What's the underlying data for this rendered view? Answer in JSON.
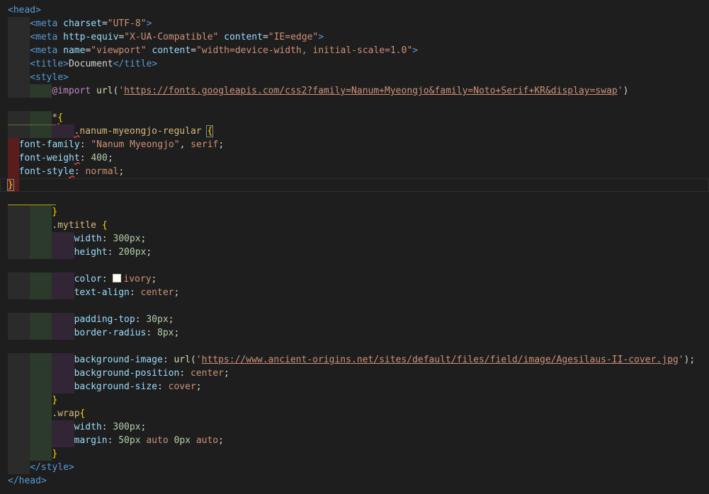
{
  "editor": {
    "lines": [
      {
        "indent": "",
        "tokens": [
          {
            "c": "t-tag",
            "t": "<head>"
          }
        ]
      },
      {
        "indent": "    ",
        "tokens": [
          {
            "c": "t-tag",
            "t": "<meta"
          },
          {
            "c": "t-text",
            "t": " "
          },
          {
            "c": "t-attr",
            "t": "charset"
          },
          {
            "c": "t-text",
            "t": "="
          },
          {
            "c": "t-str",
            "t": "\"UTF-8\""
          },
          {
            "c": "t-tag",
            "t": ">"
          }
        ]
      },
      {
        "indent": "    ",
        "tokens": [
          {
            "c": "t-tag",
            "t": "<meta"
          },
          {
            "c": "t-text",
            "t": " "
          },
          {
            "c": "t-attr",
            "t": "http-equiv"
          },
          {
            "c": "t-text",
            "t": "="
          },
          {
            "c": "t-str",
            "t": "\"X-UA-Compatible\""
          },
          {
            "c": "t-text",
            "t": " "
          },
          {
            "c": "t-attr",
            "t": "content"
          },
          {
            "c": "t-text",
            "t": "="
          },
          {
            "c": "t-str",
            "t": "\"IE=edge\""
          },
          {
            "c": "t-tag",
            "t": ">"
          }
        ]
      },
      {
        "indent": "    ",
        "tokens": [
          {
            "c": "t-tag",
            "t": "<meta"
          },
          {
            "c": "t-text",
            "t": " "
          },
          {
            "c": "t-attr",
            "t": "name"
          },
          {
            "c": "t-text",
            "t": "="
          },
          {
            "c": "t-str",
            "t": "\"viewport\""
          },
          {
            "c": "t-text",
            "t": " "
          },
          {
            "c": "t-attr",
            "t": "content"
          },
          {
            "c": "t-text",
            "t": "="
          },
          {
            "c": "t-str",
            "t": "\"width=device-width, initial-scale=1.0\""
          },
          {
            "c": "t-tag",
            "t": ">"
          }
        ]
      },
      {
        "indent": "    ",
        "tokens": [
          {
            "c": "t-tag",
            "t": "<title>"
          },
          {
            "c": "t-text",
            "t": "Document"
          },
          {
            "c": "t-tag",
            "t": "</title>"
          }
        ]
      },
      {
        "indent": "    ",
        "tokens": [
          {
            "c": "t-tag",
            "t": "<style>"
          }
        ]
      },
      {
        "indent": "        ",
        "tokens": [
          {
            "c": "t-at",
            "t": "@import"
          },
          {
            "c": "t-text",
            "t": " "
          },
          {
            "c": "t-fn",
            "t": "url"
          },
          {
            "c": "t-text",
            "t": "("
          },
          {
            "c": "t-str",
            "t": "'"
          },
          {
            "c": "t-str t-link",
            "t": "https://fonts.googleapis.com/css2?family=Nanum+Myeongjo&family=Noto+Serif+KR&display=swap"
          },
          {
            "c": "t-str",
            "t": "'"
          },
          {
            "c": "t-text",
            "t": ")"
          }
        ]
      },
      {
        "indent": "",
        "tokens": []
      },
      {
        "indent": "        ",
        "tokens": [
          {
            "c": "t-sel",
            "t": "*"
          },
          {
            "c": "t-brace squiggle",
            "t": "{"
          }
        ]
      },
      {
        "indent": "            ",
        "tokens": [
          {
            "c": "t-sel squiggle",
            "t": "."
          },
          {
            "c": "t-sel",
            "t": "nanum-myeongjo-regular "
          },
          {
            "c": "t-brace cursor-box",
            "t": "{"
          }
        ]
      },
      {
        "indent": "  ",
        "tokens": [
          {
            "c": "t-prop",
            "t": "font-family"
          },
          {
            "c": "t-text",
            "t": ": "
          },
          {
            "c": "t-val",
            "t": "\"Nanum Myeongjo\""
          },
          {
            "c": "t-text",
            "t": ", "
          },
          {
            "c": "t-val",
            "t": "serif"
          },
          {
            "c": "t-text",
            "t": ";"
          }
        ]
      },
      {
        "indent": "  ",
        "tokens": [
          {
            "c": "t-prop",
            "t": "font-weigh"
          },
          {
            "c": "t-prop squiggle",
            "t": "t"
          },
          {
            "c": "t-text",
            "t": ": "
          },
          {
            "c": "t-num",
            "t": "400"
          },
          {
            "c": "t-text",
            "t": ";"
          }
        ]
      },
      {
        "indent": "  ",
        "tokens": [
          {
            "c": "t-prop",
            "t": "font-styl"
          },
          {
            "c": "t-prop squiggle",
            "t": "e"
          },
          {
            "c": "t-text",
            "t": ": "
          },
          {
            "c": "t-val",
            "t": "normal"
          },
          {
            "c": "t-text",
            "t": ";"
          }
        ]
      },
      {
        "indent": "",
        "tokens": [
          {
            "c": "t-brace cursor-box",
            "t": "}"
          }
        ]
      },
      {
        "indent": "",
        "tokens": []
      },
      {
        "indent": "        ",
        "tokens": [
          {
            "c": "t-brace",
            "t": "}"
          }
        ]
      },
      {
        "indent": "        ",
        "tokens": [
          {
            "c": "t-sel",
            "t": ".mytitle"
          },
          {
            "c": "t-text",
            "t": " "
          },
          {
            "c": "t-brace",
            "t": "{"
          }
        ]
      },
      {
        "indent": "            ",
        "tokens": [
          {
            "c": "t-prop",
            "t": "width"
          },
          {
            "c": "t-text",
            "t": ": "
          },
          {
            "c": "t-num",
            "t": "300px"
          },
          {
            "c": "t-text",
            "t": ";"
          }
        ]
      },
      {
        "indent": "            ",
        "tokens": [
          {
            "c": "t-prop",
            "t": "height"
          },
          {
            "c": "t-text",
            "t": ": "
          },
          {
            "c": "t-num",
            "t": "200px"
          },
          {
            "c": "t-text",
            "t": ";"
          }
        ]
      },
      {
        "indent": "",
        "tokens": []
      },
      {
        "indent": "            ",
        "tokens": [
          {
            "c": "t-prop",
            "t": "color"
          },
          {
            "c": "t-text",
            "t": ": "
          },
          {
            "c": "swatch",
            "t": ""
          },
          {
            "c": "t-val",
            "t": "ivory"
          },
          {
            "c": "t-text",
            "t": ";"
          }
        ]
      },
      {
        "indent": "            ",
        "tokens": [
          {
            "c": "t-prop",
            "t": "text-align"
          },
          {
            "c": "t-text",
            "t": ": "
          },
          {
            "c": "t-val",
            "t": "center"
          },
          {
            "c": "t-text",
            "t": ";"
          }
        ]
      },
      {
        "indent": "",
        "tokens": []
      },
      {
        "indent": "            ",
        "tokens": [
          {
            "c": "t-prop",
            "t": "padding-top"
          },
          {
            "c": "t-text",
            "t": ": "
          },
          {
            "c": "t-num",
            "t": "30px"
          },
          {
            "c": "t-text",
            "t": ";"
          }
        ]
      },
      {
        "indent": "            ",
        "tokens": [
          {
            "c": "t-prop",
            "t": "border-radius"
          },
          {
            "c": "t-text",
            "t": ": "
          },
          {
            "c": "t-num",
            "t": "8px"
          },
          {
            "c": "t-text",
            "t": ";"
          }
        ]
      },
      {
        "indent": "",
        "tokens": []
      },
      {
        "indent": "            ",
        "tokens": [
          {
            "c": "t-prop",
            "t": "background-image"
          },
          {
            "c": "t-text",
            "t": ": "
          },
          {
            "c": "t-fn",
            "t": "url"
          },
          {
            "c": "t-text",
            "t": "("
          },
          {
            "c": "t-str",
            "t": "'"
          },
          {
            "c": "t-str t-link",
            "t": "https://www.ancient-origins.net/sites/default/files/field/image/Agesilaus-II-cover.jpg"
          },
          {
            "c": "t-str",
            "t": "'"
          },
          {
            "c": "t-text",
            "t": ");"
          }
        ]
      },
      {
        "indent": "            ",
        "tokens": [
          {
            "c": "t-prop",
            "t": "background-position"
          },
          {
            "c": "t-text",
            "t": ": "
          },
          {
            "c": "t-val",
            "t": "center"
          },
          {
            "c": "t-text",
            "t": ";"
          }
        ]
      },
      {
        "indent": "            ",
        "tokens": [
          {
            "c": "t-prop",
            "t": "background-size"
          },
          {
            "c": "t-text",
            "t": ": "
          },
          {
            "c": "t-val",
            "t": "cover"
          },
          {
            "c": "t-text",
            "t": ";"
          }
        ]
      },
      {
        "indent": "        ",
        "tokens": [
          {
            "c": "t-brace",
            "t": "}"
          }
        ]
      },
      {
        "indent": "        ",
        "tokens": [
          {
            "c": "t-sel",
            "t": ".wrap"
          },
          {
            "c": "t-brace",
            "t": "{"
          }
        ]
      },
      {
        "indent": "            ",
        "tokens": [
          {
            "c": "t-prop",
            "t": "width"
          },
          {
            "c": "t-text",
            "t": ": "
          },
          {
            "c": "t-num",
            "t": "300px"
          },
          {
            "c": "t-text",
            "t": ";"
          }
        ]
      },
      {
        "indent": "            ",
        "tokens": [
          {
            "c": "t-prop",
            "t": "margin"
          },
          {
            "c": "t-text",
            "t": ": "
          },
          {
            "c": "t-num",
            "t": "50px"
          },
          {
            "c": "t-text",
            "t": " "
          },
          {
            "c": "t-val",
            "t": "auto"
          },
          {
            "c": "t-text",
            "t": " "
          },
          {
            "c": "t-num",
            "t": "0px"
          },
          {
            "c": "t-text",
            "t": " "
          },
          {
            "c": "t-val",
            "t": "auto"
          },
          {
            "c": "t-text",
            "t": ";"
          }
        ]
      },
      {
        "indent": "        ",
        "tokens": [
          {
            "c": "t-brace",
            "t": "}"
          }
        ]
      },
      {
        "indent": "    ",
        "tokens": [
          {
            "c": "t-tag",
            "t": "</style>"
          }
        ]
      },
      {
        "indent": "",
        "tokens": [
          {
            "c": "t-tag",
            "t": "</head>"
          }
        ]
      }
    ]
  },
  "colors": {
    "background": "#1e1e1e",
    "indent_guide_1": "#2b2b2b",
    "indent_guide_2": "#2b3a2b",
    "indent_guide_3": "#322535",
    "error_gutter": "#5a1d1d"
  }
}
